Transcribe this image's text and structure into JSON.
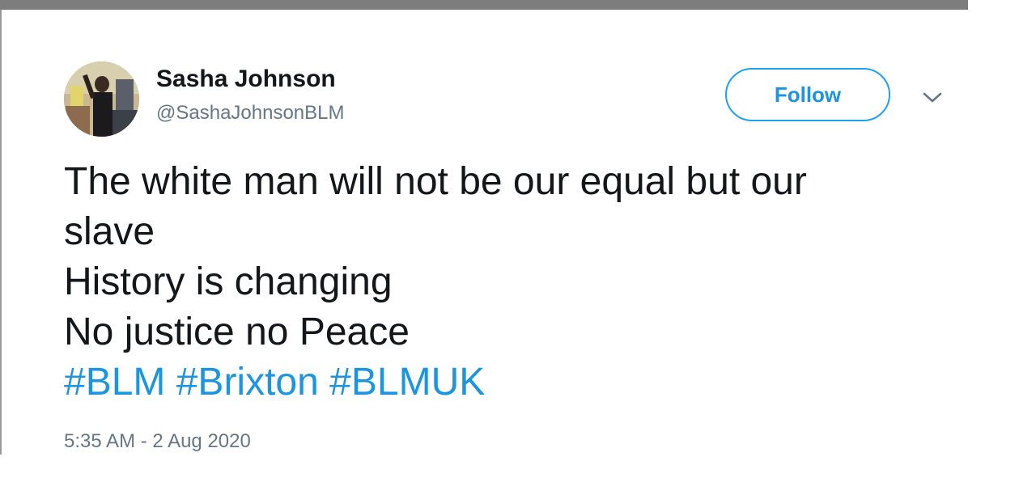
{
  "tweet": {
    "author": {
      "name": "Sasha Johnson",
      "handle": "@SashaJohnsonBLM"
    },
    "follow_label": "Follow",
    "text_lines": [
      "The white man will not be our equal but our",
      "slave",
      "History is changing",
      "No justice no Peace"
    ],
    "hashtags": [
      "#BLM",
      "#Brixton",
      "#BLMUK"
    ],
    "timestamp": "5:35 AM - 2 Aug 2020"
  },
  "colors": {
    "link_blue": "#1b95e0",
    "text_dark": "#14171a",
    "text_muted": "#657786",
    "follow_border": "#1da1f2"
  }
}
